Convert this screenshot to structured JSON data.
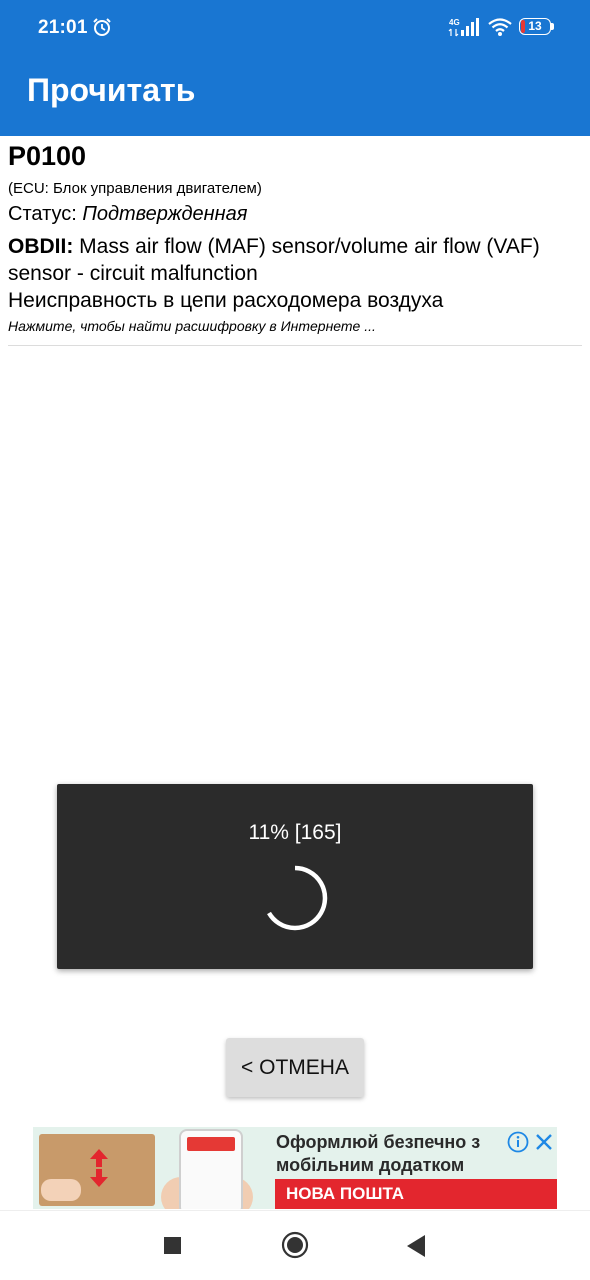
{
  "status_bar": {
    "time": "21:01",
    "network": "4G",
    "battery": "13",
    "battery_level": 0.13,
    "battery_color": "#e53935"
  },
  "app_bar": {
    "title": "Прочитать",
    "color": "#1976d2"
  },
  "trouble_code": {
    "code": "P0100",
    "ecu": "(ECU: Блок управления двигателем)",
    "status_label": "Статус: ",
    "status_value": "Подтвержденная",
    "standard_label": "OBDII:",
    "description_en": "Mass air flow (MAF) sensor/volume air flow (VAF) sensor - circuit malfunction",
    "description_ru": "Неисправность в цепи расходомера воздуха",
    "hint": "Нажмите, чтобы найти расшифровку в Интернете ..."
  },
  "progress_dialog": {
    "text": "11% [165]",
    "background": "#2b2b2b"
  },
  "cancel_button": {
    "label": "< ОТМЕНА"
  },
  "ad": {
    "headline": "Оформлюй безпечно з мобільним додатком",
    "brand": "НОВА ПОШТА",
    "brand_color": "#e3262e",
    "icons": [
      "info-icon",
      "close-icon"
    ]
  },
  "navigation": {
    "icons": [
      "recent-apps-icon",
      "home-icon",
      "back-icon"
    ]
  }
}
